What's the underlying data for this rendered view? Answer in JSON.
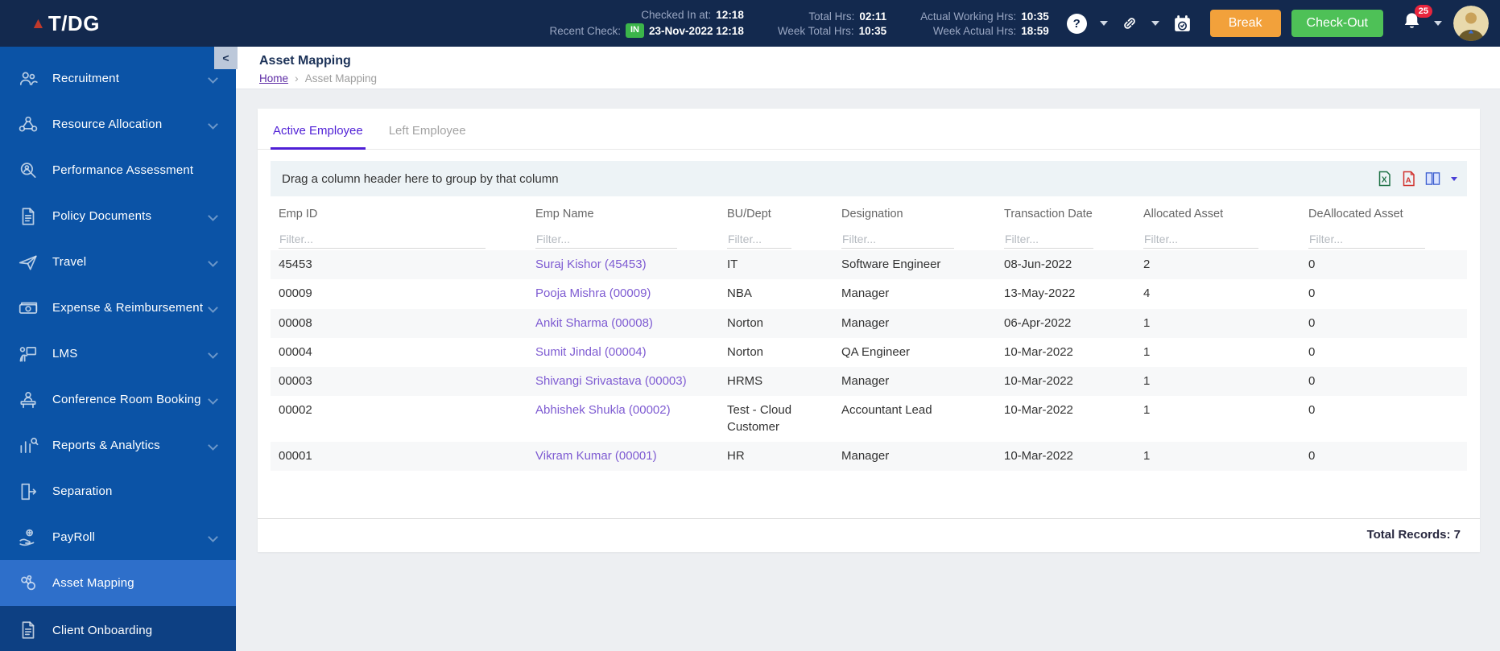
{
  "topbar": {
    "brand": "T/DG",
    "attendance": {
      "checked_in_label": "Checked In at:",
      "checked_in_value": "12:18",
      "recent_check_label": "Recent Check:",
      "recent_check_badge": "IN",
      "recent_check_value": "23-Nov-2022 12:18",
      "total_hrs_label": "Total Hrs:",
      "total_hrs_value": "02:11",
      "week_total_label": "Week Total Hrs:",
      "week_total_value": "10:35",
      "actual_working_label": "Actual Working Hrs:",
      "actual_working_value": "10:35",
      "week_actual_label": "Week Actual Hrs:",
      "week_actual_value": "18:59"
    },
    "break_label": "Break",
    "checkout_label": "Check-Out",
    "notification_count": "25"
  },
  "sidebar": {
    "items": [
      {
        "label": "Recruitment",
        "icon": "people-icon",
        "expandable": true,
        "active": false,
        "dark": false
      },
      {
        "label": "Resource Allocation",
        "icon": "org-network-icon",
        "expandable": true,
        "active": false,
        "dark": false
      },
      {
        "label": "Performance Assessment",
        "icon": "search-person-icon",
        "expandable": false,
        "active": false,
        "dark": false
      },
      {
        "label": "Policy Documents",
        "icon": "document-icon",
        "expandable": true,
        "active": false,
        "dark": false
      },
      {
        "label": "Travel",
        "icon": "airplane-icon",
        "expandable": true,
        "active": false,
        "dark": false
      },
      {
        "label": "Expense & Reimbursement",
        "icon": "money-icon",
        "expandable": true,
        "active": false,
        "dark": false
      },
      {
        "label": "LMS",
        "icon": "training-icon",
        "expandable": true,
        "active": false,
        "dark": false
      },
      {
        "label": "Conference Room Booking",
        "icon": "podium-icon",
        "expandable": true,
        "active": false,
        "dark": false
      },
      {
        "label": "Reports & Analytics",
        "icon": "bar-chart-icon",
        "expandable": true,
        "active": false,
        "dark": false
      },
      {
        "label": "Separation",
        "icon": "exit-door-icon",
        "expandable": false,
        "active": false,
        "dark": false
      },
      {
        "label": "PayRoll",
        "icon": "hand-coin-icon",
        "expandable": true,
        "active": false,
        "dark": false
      },
      {
        "label": "Asset Mapping",
        "icon": "linked-assets-icon",
        "expandable": false,
        "active": true,
        "dark": false
      },
      {
        "label": "Client Onboarding",
        "icon": "client-document-icon",
        "expandable": false,
        "active": false,
        "dark": true
      }
    ]
  },
  "page": {
    "title": "Asset Mapping",
    "collapse_glyph": "<",
    "breadcrumb": {
      "home": "Home",
      "separator": "›",
      "current": "Asset Mapping"
    }
  },
  "tabs": [
    {
      "label": "Active Employee",
      "active": true
    },
    {
      "label": "Left Employee",
      "active": false
    }
  ],
  "grid": {
    "group_panel_text": "Drag a column header here to group by that column",
    "filter_placeholder": "Filter...",
    "columns": [
      "Emp ID",
      "Emp Name",
      "BU/Dept",
      "Designation",
      "Transaction Date",
      "Allocated Asset",
      "DeAllocated Asset"
    ],
    "rows": [
      {
        "emp_id": "45453",
        "emp_name": "Suraj Kishor (45453)",
        "bu_dept": "IT",
        "designation": "Software Engineer",
        "transaction_date": "08-Jun-2022",
        "allocated": "2",
        "deallocated": "0"
      },
      {
        "emp_id": "00009",
        "emp_name": "Pooja Mishra (00009)",
        "bu_dept": "NBA",
        "designation": "Manager",
        "transaction_date": "13-May-2022",
        "allocated": "4",
        "deallocated": "0"
      },
      {
        "emp_id": "00008",
        "emp_name": "Ankit Sharma (00008)",
        "bu_dept": "Norton",
        "designation": "Manager",
        "transaction_date": "06-Apr-2022",
        "allocated": "1",
        "deallocated": "0"
      },
      {
        "emp_id": "00004",
        "emp_name": "Sumit Jindal (00004)",
        "bu_dept": "Norton",
        "designation": "QA Engineer",
        "transaction_date": "10-Mar-2022",
        "allocated": "1",
        "deallocated": "0"
      },
      {
        "emp_id": "00003",
        "emp_name": "Shivangi Srivastava (00003)",
        "bu_dept": "HRMS",
        "designation": "Manager",
        "transaction_date": "10-Mar-2022",
        "allocated": "1",
        "deallocated": "0"
      },
      {
        "emp_id": "00002",
        "emp_name": "Abhishek Shukla (00002)",
        "bu_dept": "Test - Cloud Customer",
        "designation": "Accountant Lead",
        "transaction_date": "10-Mar-2022",
        "allocated": "1",
        "deallocated": "0"
      },
      {
        "emp_id": "00001",
        "emp_name": "Vikram Kumar (00001)",
        "bu_dept": "HR",
        "designation": "Manager",
        "transaction_date": "10-Mar-2022",
        "allocated": "1",
        "deallocated": "0"
      }
    ],
    "total_records_label": "Total Records:",
    "total_records_value": "7"
  },
  "colors": {
    "topbar_navy": "#13294e",
    "sidebar_blue": "#0b53a6",
    "sidebar_active_blue": "#2e6fca",
    "sidebar_dark_blue": "#0d4083",
    "accent_purple": "#4f1fd6",
    "link_purple": "#7e5bd2",
    "breadcrumb_purple": "#5e2ca5",
    "break_orange": "#f2a13b",
    "checkout_green": "#4ec157",
    "in_badge_green": "#3bb54a",
    "notification_red": "#e8253d",
    "excel_green": "#1e7145",
    "pdf_red": "#d1332e",
    "column_chooser_blue": "#3d5fd0"
  }
}
